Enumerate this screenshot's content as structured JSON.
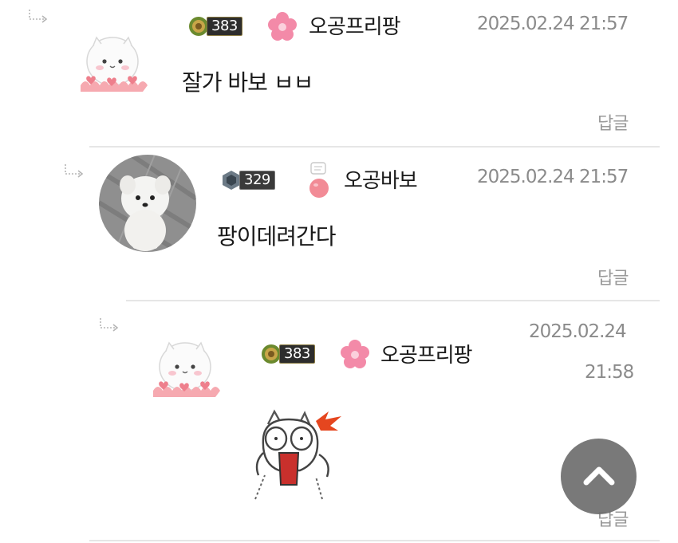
{
  "comments": [
    {
      "username": "오공프리팡",
      "level": "383",
      "timestamp": "2025.02.24 21:57",
      "text": "잘가 바보 ㅂㅂ",
      "reply_label": "답글"
    },
    {
      "username": "오공바보",
      "level": "329",
      "timestamp": "2025.02.24 21:57",
      "text": "팡이데려간다",
      "reply_label": "답글"
    },
    {
      "username": "오공프리팡",
      "level": "383",
      "timestamp_date": "2025.02.24",
      "timestamp_time": "21:58",
      "reply_label": "답글"
    }
  ],
  "icons": {
    "reply_arrow": "reply-arrow-icon",
    "scroll_top": "chevron-up-icon",
    "flower": "pink-flower-icon",
    "rank_medal": "rank-medal-icon"
  },
  "colors": {
    "timestamp": "#8b8b8b",
    "reply_button": "#9a9a9a",
    "divider": "#e6e6e6",
    "flower": "#f07a9a",
    "scroll_button": "#6e6e6e"
  }
}
